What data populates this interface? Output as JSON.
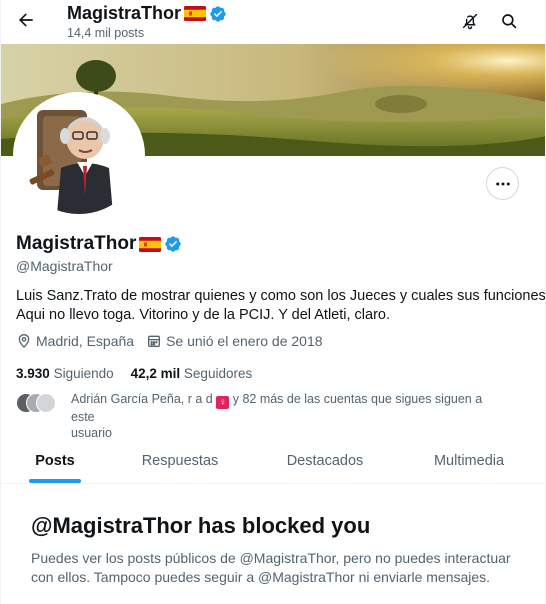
{
  "header": {
    "name": "MagistraThor",
    "posts_count": "14,4 mil posts"
  },
  "profile": {
    "name": "MagistraThor",
    "handle": "@MagistraThor",
    "bio_line1": "Luis Sanz.Trato de mostrar quienes y como son los Jueces y cuales sus funciones.",
    "bio_line2": "Aqui no llevo toga. Vitorino y de la PCIJ. Y del Atleti, claro.",
    "location": "Madrid, España",
    "joined": "Se unió el enero de 2018",
    "following_count": "3.930",
    "following_label": "Siguiendo",
    "followers_count": "42,2 mil",
    "followers_label": "Seguidores",
    "known_followers_prefix": "Adrián García Peña, r a d",
    "known_followers_suffix": "y 82 más de las cuentas que sigues siguen a este",
    "known_followers_line2": "usuario"
  },
  "tabs": [
    {
      "label": "Posts",
      "active": true
    },
    {
      "label": "Respuestas",
      "active": false
    },
    {
      "label": "Destacados",
      "active": false
    },
    {
      "label": "Multimedia",
      "active": false
    }
  ],
  "blocked": {
    "title": "@MagistraThor has blocked you",
    "line1": "Puedes ver los posts públicos de @MagistraThor, pero no puedes interactuar",
    "line2": "con ellos. Tampoco puedes seguir a @MagistraThor ni enviarle mensajes."
  },
  "colors": {
    "accent": "#1d9bf0",
    "verified": "#1d9bf0",
    "secondary_text": "#536471",
    "primary_text": "#0f1419"
  },
  "icons": {
    "back": "arrow-left-icon",
    "notifications_off": "bell-slash-icon",
    "search": "search-icon",
    "more": "more-horizontal-icon",
    "location": "location-pin-icon",
    "calendar": "calendar-icon",
    "verified": "verified-badge-icon",
    "flag": "spain-flag-icon"
  }
}
